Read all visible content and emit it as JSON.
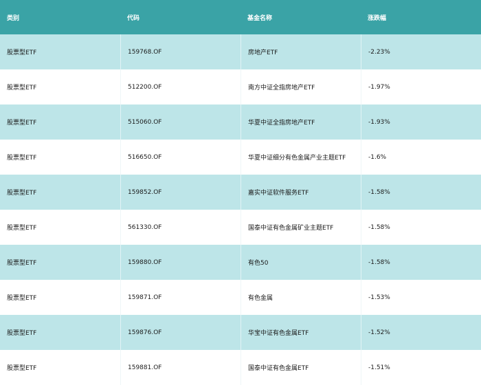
{
  "table": {
    "headers": [
      "类别",
      "代码",
      "基金名称",
      "涨跌幅"
    ],
    "rows": [
      [
        "股票型ETF",
        "159768.OF",
        "房地产ETF",
        "-2.23%"
      ],
      [
        "股票型ETF",
        "512200.OF",
        "南方中证全指房地产ETF",
        "-1.97%"
      ],
      [
        "股票型ETF",
        "515060.OF",
        "华夏中证全指房地产ETF",
        "-1.93%"
      ],
      [
        "股票型ETF",
        "516650.OF",
        "华夏中证细分有色金属产业主题ETF",
        "-1.6%"
      ],
      [
        "股票型ETF",
        "159852.OF",
        "嘉实中证软件服务ETF",
        "-1.58%"
      ],
      [
        "股票型ETF",
        "561330.OF",
        "国泰中证有色金属矿业主题ETF",
        "-1.58%"
      ],
      [
        "股票型ETF",
        "159880.OF",
        "有色50",
        "-1.58%"
      ],
      [
        "股票型ETF",
        "159871.OF",
        "有色金属",
        "-1.53%"
      ],
      [
        "股票型ETF",
        "159876.OF",
        "华宝中证有色金属ETF",
        "-1.52%"
      ],
      [
        "股票型ETF",
        "159881.OF",
        "国泰中证有色金属ETF",
        "-1.51%"
      ]
    ]
  },
  "colors": {
    "header_bg": "#3aa3a6",
    "stripe_bg": "#bde5e8",
    "row_bg": "#ffffff"
  }
}
